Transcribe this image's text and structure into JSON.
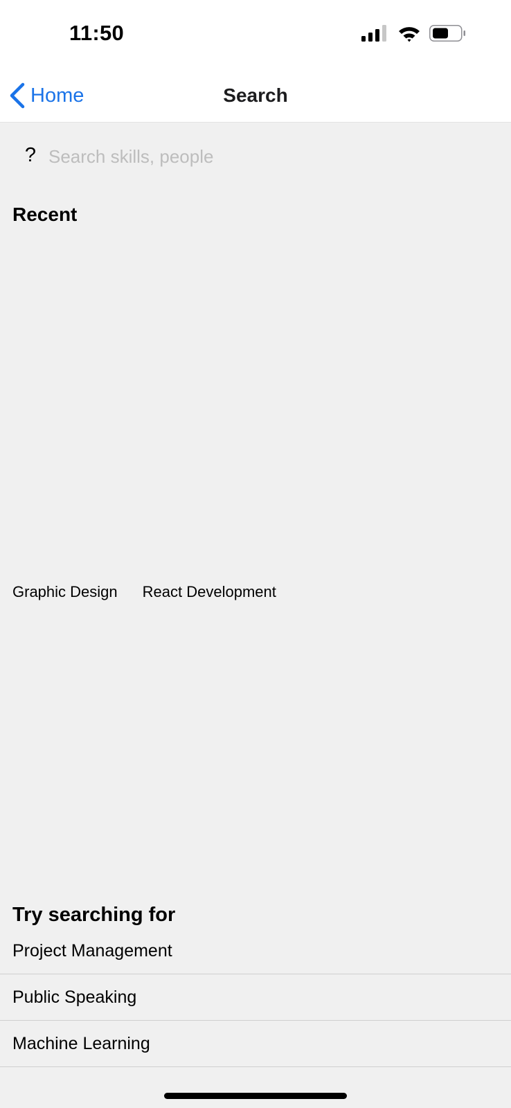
{
  "status_bar": {
    "time": "11:50",
    "icons": [
      "signal-icon",
      "wifi-icon",
      "battery-icon"
    ]
  },
  "nav": {
    "back_label": "Home",
    "title": "Search",
    "accent_color": "#1a73e8"
  },
  "search": {
    "icon_glyph": "?",
    "placeholder": "Search skills, people",
    "value": ""
  },
  "recent": {
    "heading": "Recent",
    "items": [
      "Graphic Design",
      "React Development"
    ]
  },
  "suggestions": {
    "heading": "Try searching for",
    "items": [
      "Project Management",
      "Public Speaking",
      "Machine Learning"
    ]
  }
}
